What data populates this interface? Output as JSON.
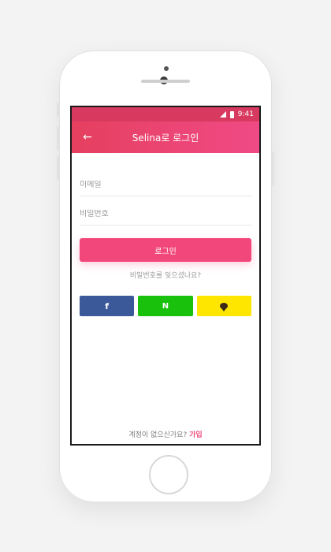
{
  "statusbar": {
    "time": "9:41"
  },
  "header": {
    "title": "Selina로 로그인"
  },
  "form": {
    "email_placeholder": "이메일",
    "password_placeholder": "비밀번호",
    "login_label": "로그인",
    "forgot_label": "비밀번호를 잊으셨나요?"
  },
  "social": {
    "facebook_label": "f",
    "naver_label": "N"
  },
  "footer": {
    "question": "계정이 없으신가요? ",
    "signup_label": "가입"
  },
  "colors": {
    "accent": "#f2477a",
    "facebook": "#3b5998",
    "naver": "#19c10c",
    "kakao": "#ffe600"
  }
}
